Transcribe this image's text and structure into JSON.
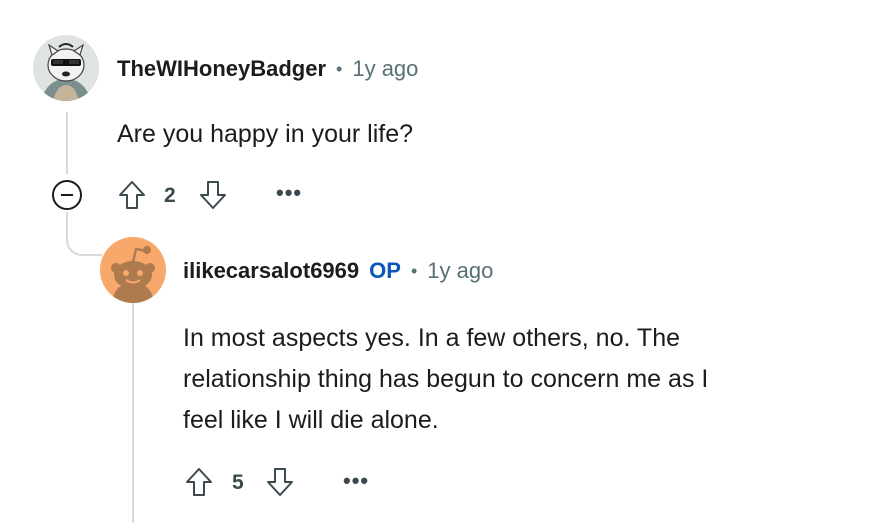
{
  "comments": [
    {
      "username": "TheWIHoneyBadger",
      "separator": "•",
      "age": "1y ago",
      "body": "Are you happy in your life?",
      "votes": "2",
      "avatar_icon": "sunglasses-badger-avatar"
    },
    {
      "username": "ilikecarsalot6969",
      "op_badge": "OP",
      "separator": "•",
      "age": "1y ago",
      "body_lines": [
        "In most aspects yes. In a few others, no. The",
        "relationship thing has begun to concern me as I",
        "feel like I will die alone."
      ],
      "votes": "5",
      "avatar_icon": "default-snoo-avatar"
    }
  ],
  "more_label": "•••",
  "colors": {
    "op_badge": "#0a58b8",
    "meta_text": "#576f76",
    "thread_line": "#d7dadc",
    "snoo_avatar_bg": "#f8a86a"
  }
}
